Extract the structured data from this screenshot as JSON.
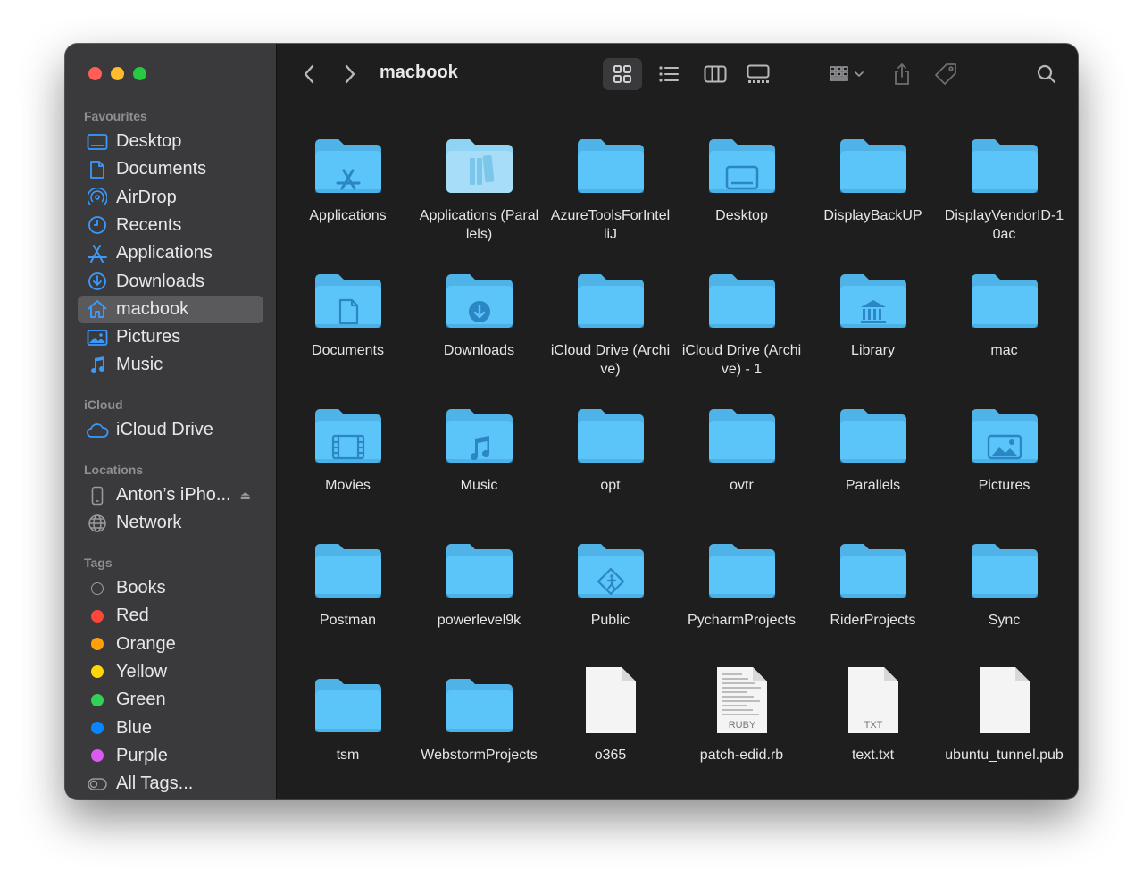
{
  "window": {
    "title": "macbook"
  },
  "sidebar": {
    "sections": {
      "favourites": "Favourites",
      "icloud": "iCloud",
      "locations": "Locations",
      "tags": "Tags"
    },
    "favourites": [
      {
        "label": "Desktop",
        "icon": "desktop-icon"
      },
      {
        "label": "Documents",
        "icon": "document-icon"
      },
      {
        "label": "AirDrop",
        "icon": "airdrop-icon"
      },
      {
        "label": "Recents",
        "icon": "clock-icon"
      },
      {
        "label": "Applications",
        "icon": "applications-icon"
      },
      {
        "label": "Downloads",
        "icon": "download-icon"
      },
      {
        "label": "macbook",
        "icon": "home-icon",
        "selected": true
      },
      {
        "label": "Pictures",
        "icon": "pictures-icon"
      },
      {
        "label": "Music",
        "icon": "music-icon"
      }
    ],
    "icloud": [
      {
        "label": "iCloud Drive",
        "icon": "cloud-icon"
      }
    ],
    "locations": [
      {
        "label": "Anton’s iPho...",
        "icon": "iphone-icon",
        "eject": true
      },
      {
        "label": "Network",
        "icon": "network-icon"
      }
    ],
    "tags": [
      {
        "label": "Books",
        "color": "none"
      },
      {
        "label": "Red",
        "color": "#ff453a"
      },
      {
        "label": "Orange",
        "color": "#ff9f0a"
      },
      {
        "label": "Yellow",
        "color": "#ffd60a"
      },
      {
        "label": "Green",
        "color": "#30d158"
      },
      {
        "label": "Blue",
        "color": "#0a84ff"
      },
      {
        "label": "Purple",
        "color": "#da5af2"
      },
      {
        "label": "All Tags...",
        "color": "all"
      }
    ]
  },
  "toolbar": {
    "back": "chevron-left-icon",
    "forward": "chevron-right-icon",
    "views": [
      "icon-view-icon",
      "list-view-icon",
      "column-view-icon",
      "gallery-view-icon"
    ],
    "active_view": "icon-view-icon",
    "group": "group-by-icon",
    "share": "share-icon",
    "tag": "tag-icon",
    "search": "search-icon"
  },
  "items": [
    {
      "name": "Applications",
      "type": "folder",
      "glyph": "apps"
    },
    {
      "name": "Applications (Parallels)",
      "type": "folder",
      "glyph": "parallels"
    },
    {
      "name": "AzureToolsForIntelliJ",
      "type": "folder",
      "glyph": ""
    },
    {
      "name": "Desktop",
      "type": "folder",
      "glyph": "desktop"
    },
    {
      "name": "DisplayBackUP",
      "type": "folder",
      "glyph": ""
    },
    {
      "name": "DisplayVendorID-10ac",
      "type": "folder",
      "glyph": ""
    },
    {
      "name": "Documents",
      "type": "folder",
      "glyph": "document"
    },
    {
      "name": "Downloads",
      "type": "folder",
      "glyph": "download"
    },
    {
      "name": "iCloud Drive (Archive)",
      "type": "folder",
      "glyph": ""
    },
    {
      "name": "iCloud Drive (Archive) - 1",
      "type": "folder",
      "glyph": ""
    },
    {
      "name": "Library",
      "type": "folder",
      "glyph": "library"
    },
    {
      "name": "mac",
      "type": "folder",
      "glyph": ""
    },
    {
      "name": "Movies",
      "type": "folder",
      "glyph": "movies"
    },
    {
      "name": "Music",
      "type": "folder",
      "glyph": "music"
    },
    {
      "name": "opt",
      "type": "folder",
      "glyph": ""
    },
    {
      "name": "ovtr",
      "type": "folder",
      "glyph": ""
    },
    {
      "name": "Parallels",
      "type": "folder",
      "glyph": ""
    },
    {
      "name": "Pictures",
      "type": "folder",
      "glyph": "pictures"
    },
    {
      "name": "Postman",
      "type": "folder",
      "glyph": ""
    },
    {
      "name": "powerlevel9k",
      "type": "folder",
      "glyph": ""
    },
    {
      "name": "Public",
      "type": "folder",
      "glyph": "public"
    },
    {
      "name": "PycharmProjects",
      "type": "folder",
      "glyph": ""
    },
    {
      "name": "RiderProjects",
      "type": "folder",
      "glyph": ""
    },
    {
      "name": "Sync",
      "type": "folder",
      "glyph": ""
    },
    {
      "name": "tsm",
      "type": "folder",
      "glyph": ""
    },
    {
      "name": "WebstormProjects",
      "type": "folder",
      "glyph": ""
    },
    {
      "name": "o365",
      "type": "file",
      "badge": ""
    },
    {
      "name": "patch-edid.rb",
      "type": "file",
      "badge": "RUBY"
    },
    {
      "name": "text.txt",
      "type": "file",
      "badge": "TXT"
    },
    {
      "name": "ubuntu_tunnel.pub",
      "type": "file",
      "badge": ""
    }
  ]
}
